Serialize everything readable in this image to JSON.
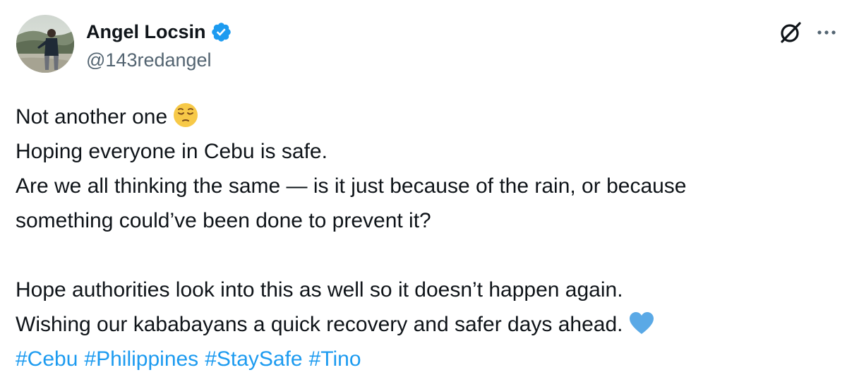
{
  "author": {
    "display_name": "Angel Locsin",
    "handle": "@143redangel",
    "verified": true,
    "verified_badge_color": "#1d9bf0"
  },
  "header_actions": {
    "grok_icon": "grok-icon",
    "more_icon": "more-options-icon"
  },
  "tweet": {
    "line1": "Not another one",
    "line1_emoji": "pensive-face-emoji",
    "line2": "Hoping everyone in Cebu is safe.",
    "line3": "Are we all thinking the same — is it just because of the rain, or because",
    "line4": "something could’ve been done to prevent it?",
    "line5": "Hope authorities look into this as well so it doesn’t happen again.",
    "line6": "Wishing our kababayans a quick recovery and safer days ahead.",
    "line6_emoji": "blue-heart-emoji",
    "hashtags": [
      "#Cebu",
      "#Philippines",
      "#StaySafe",
      "#Tino"
    ]
  },
  "colors": {
    "text": "#0f1419",
    "secondary_text": "#536471",
    "link": "#1d9bf0",
    "background": "#ffffff"
  }
}
